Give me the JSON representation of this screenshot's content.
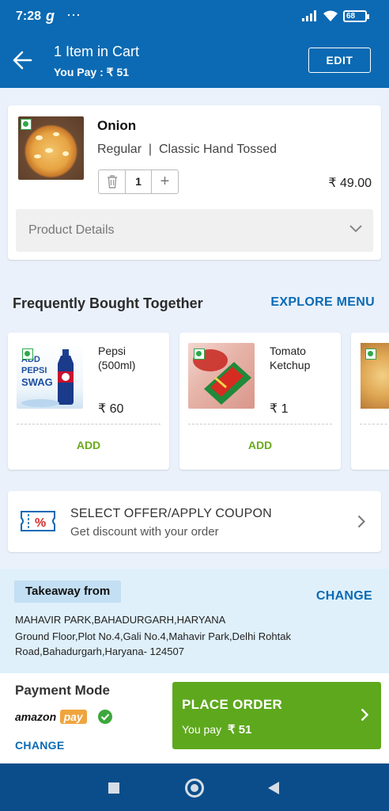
{
  "status": {
    "time": "7:28",
    "app_glyph": "g",
    "battery": "68"
  },
  "header": {
    "title": "1 Item in Cart",
    "you_pay": "You Pay : ₹ 51",
    "edit_label": "EDIT"
  },
  "cart_item": {
    "name": "Onion",
    "variant": "Regular  |  Classic Hand Tossed",
    "quantity": "1",
    "price": "₹ 49.00",
    "details_label": "Product Details"
  },
  "fbt": {
    "title": "Frequently Bought Together",
    "explore_label": "EXPLORE MENU",
    "products": [
      {
        "name": "Pepsi (500ml)",
        "price": "₹ 60",
        "add_label": "ADD",
        "img_text": "ADD PEPSI SWAG"
      },
      {
        "name": "Tomato Ketchup",
        "price": "₹ 1",
        "add_label": "ADD"
      }
    ]
  },
  "coupon": {
    "title": "SELECT OFFER/APPLY COUPON",
    "subtitle": "Get discount with your order"
  },
  "takeaway": {
    "label": "Takeaway from",
    "change_label": "CHANGE",
    "address_line1": "MAHAVIR PARK,BAHADURGARH,HARYANA",
    "address_line2": "Ground Floor,Plot No.4,Gali No.4,Mahavir Park,Delhi Rohtak Road,Bahadurgarh,Haryana- 124507"
  },
  "payment": {
    "label": "Payment Mode",
    "method_a": "amazon",
    "method_b": "pay",
    "change_label": "CHANGE",
    "place_order_label": "PLACE ORDER",
    "you_pay_label": "You pay",
    "you_pay_amount": "₹ 51"
  },
  "colors": {
    "primary": "#0b6ab3",
    "accent_green": "#5ea81d",
    "veg_green": "#2ea84a",
    "bg": "#eaf1fb"
  }
}
